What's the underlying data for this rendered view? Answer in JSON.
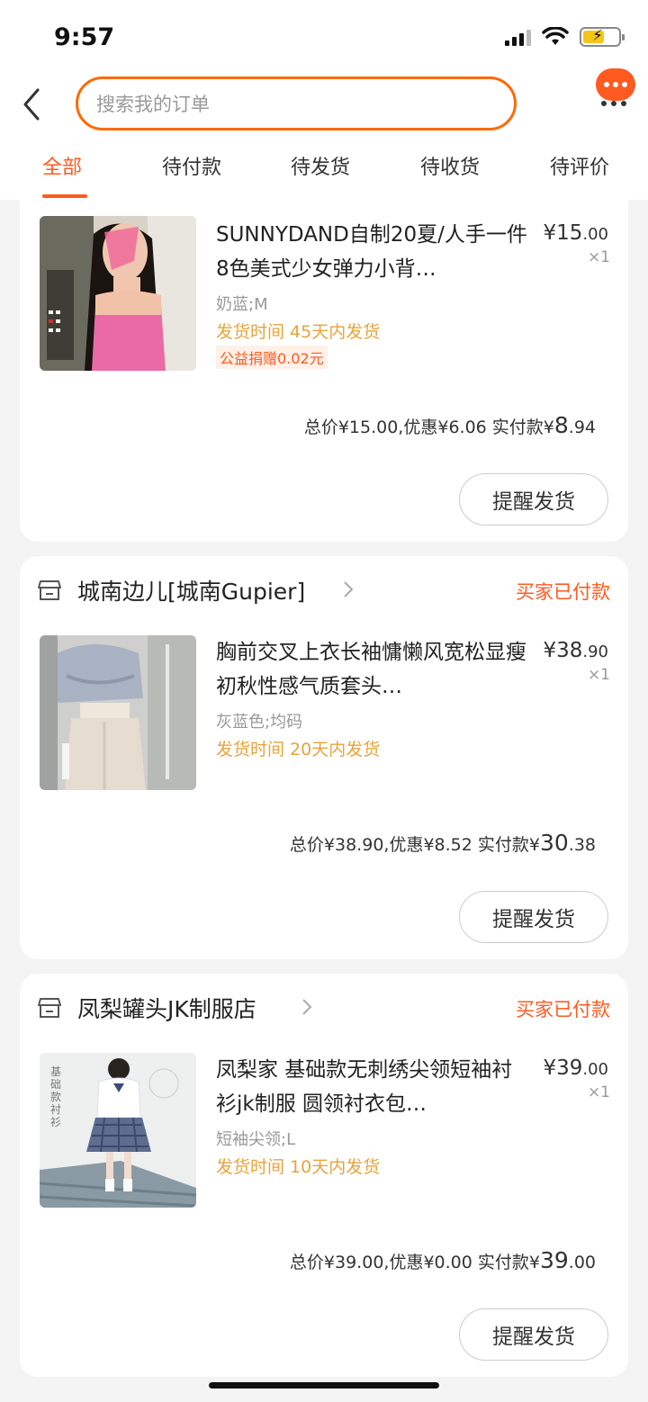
{
  "status_bar": {
    "time": "9:57"
  },
  "header": {
    "search_placeholder": "搜索我的订单"
  },
  "tabs": [
    {
      "label": "全部",
      "active": true
    },
    {
      "label": "待付款"
    },
    {
      "label": "待发货"
    },
    {
      "label": "待收货"
    },
    {
      "label": "待评价"
    }
  ],
  "accent_color": "#ff5a1f",
  "orders": [
    {
      "shop_name": "",
      "status": "",
      "item": {
        "title": "SUNNYDAND自制20夏/人手一件8色美式少女弹力小背…",
        "price_int": "¥15",
        "price_dec": ".00",
        "qty": "×1",
        "spec": "奶蓝;M",
        "ship": "发货时间  45天内发货",
        "badge": "公益捐赠0.02元"
      },
      "summary": {
        "text": "总价¥15.00,优惠¥6.06 实付款¥",
        "paid_int": "8",
        "paid_dec": ".94"
      },
      "button": "提醒发货"
    },
    {
      "shop_name": "城南边儿[城南Gupier]",
      "status": "买家已付款",
      "item": {
        "title": "胸前交叉上衣长袖慵懒风宽松显瘦初秋性感气质套头…",
        "price_int": "¥38",
        "price_dec": ".90",
        "qty": "×1",
        "spec": "灰蓝色;均码",
        "ship": "发货时间  20天内发货"
      },
      "summary": {
        "text": "总价¥38.90,优惠¥8.52 实付款¥",
        "paid_int": "30",
        "paid_dec": ".38"
      },
      "button": "提醒发货"
    },
    {
      "shop_name": "凤梨罐头JK制服店",
      "status": "买家已付款",
      "item": {
        "title": "凤梨家 基础款无刺绣尖领短袖衬衫jk制服 圆领衬衣包…",
        "price_int": "¥39",
        "price_dec": ".00",
        "qty": "×1",
        "spec": "短袖尖领;L",
        "ship": "发货时间  10天内发货",
        "image_text_lines": [
          "基",
          "础",
          "款",
          "衬",
          "衫"
        ]
      },
      "summary": {
        "text": "总价¥39.00,优惠¥0.00 实付款¥",
        "paid_int": "39",
        "paid_dec": ".00"
      },
      "button": "提醒发货"
    }
  ]
}
